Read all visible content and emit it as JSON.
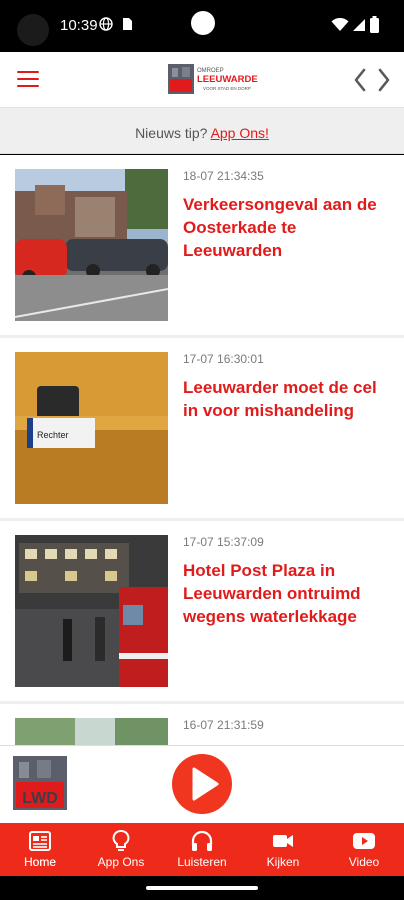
{
  "status": {
    "time": "10:39"
  },
  "tip": {
    "text": "Nieuws tip?",
    "link": "App Ons!"
  },
  "logo": {
    "line1": "OMROEP",
    "line2": "LEEUWARDEN",
    "tagline": "VOOR STAD EN DORP"
  },
  "articles": [
    {
      "time": "18-07 21:34:35",
      "title": "Verkeersongeval aan de Oosterkade te Leeuwarden"
    },
    {
      "time": "17-07 16:30:01",
      "title": "Leeuwarder moet de cel in voor mishandeling",
      "photo_caption": "Rechter"
    },
    {
      "time": "17-07 15:37:09",
      "title": "Hotel Post Plaza in Leeuwarden ontruimd wegens waterlekkage"
    },
    {
      "time": "16-07 21:31:59",
      "title": ""
    }
  ],
  "player": {
    "logo_text": "LWD"
  },
  "tabs": [
    {
      "label": "Home",
      "icon": "newspaper-icon"
    },
    {
      "label": "App Ons",
      "icon": "lightbulb-icon"
    },
    {
      "label": "Luisteren",
      "icon": "headphones-icon"
    },
    {
      "label": "Kijken",
      "icon": "video-camera-icon"
    },
    {
      "label": "Video",
      "icon": "play-box-icon"
    }
  ],
  "colors": {
    "brand": "#e11b1b",
    "tabbar": "#ee2a1a",
    "play": "#f0361f"
  }
}
